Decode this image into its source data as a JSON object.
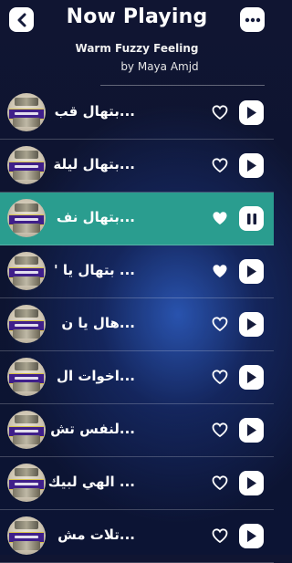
{
  "header": {
    "title": "Now Playing",
    "song_title": "Warm Fuzzy Feeling",
    "artist": "by Maya Amjd",
    "back_icon": "chevron-left-icon",
    "more_icon": "more-dots-icon"
  },
  "colors": {
    "active_row": "#2a9d8f",
    "background": "#0d1430",
    "button": "#ffffff",
    "icon": "#141a3a"
  },
  "tracks": [
    {
      "name": "بتهال قب...",
      "liked": false,
      "playing": false
    },
    {
      "name": "بتهال ليلة...",
      "liked": false,
      "playing": false
    },
    {
      "name": "بتهال نف...",
      "liked": true,
      "playing": true
    },
    {
      "name": "' بتهال يا ...",
      "liked": true,
      "playing": false
    },
    {
      "name": "هال يا ن...",
      "liked": false,
      "playing": false
    },
    {
      "name": "اخوات ال...",
      "liked": false,
      "playing": false
    },
    {
      "name": "لنفس تش...",
      "liked": false,
      "playing": false
    },
    {
      "name": "الهي لبيك ...",
      "liked": false,
      "playing": false
    },
    {
      "name": "تلات مش...",
      "liked": false,
      "playing": false
    }
  ]
}
